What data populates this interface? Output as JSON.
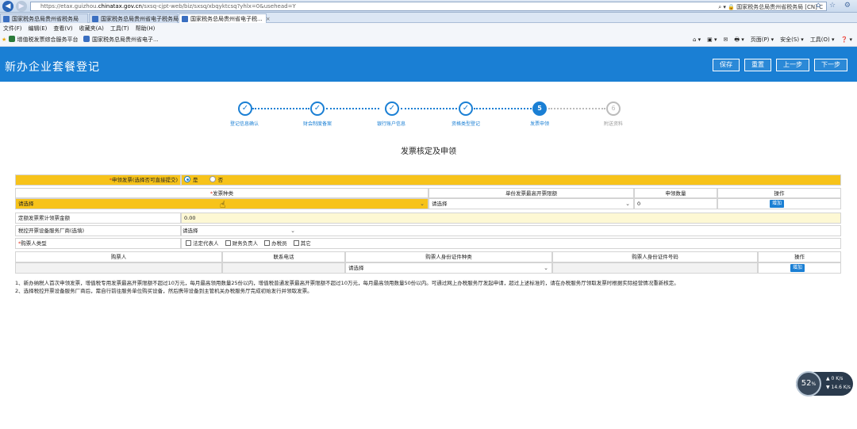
{
  "browser": {
    "url_prefix": "https://etax.guizhou.",
    "url_domain": "chinatax.gov.cn",
    "url_path": "/sxsq-cjpt-web/biz/sxsq/xbqyktcsq?yhlx=0&usehead=Y",
    "site_identity": "⌕ ▾ 🔒 国家税务总局贵州省税务局 [CN] C",
    "tabs": [
      {
        "label": "国家税务总局贵州省税务局"
      },
      {
        "label": "国家税务总局贵州省电子税务局"
      },
      {
        "label": "国家税务总局贵州省电子税...",
        "close": "×"
      }
    ],
    "menu": [
      "文件(F)",
      "编辑(E)",
      "查看(V)",
      "收藏夹(A)",
      "工具(T)",
      "帮助(H)"
    ],
    "favorites": [
      "增值税发票综合服务平台",
      "国家税务总局贵州省电子..."
    ],
    "commands": [
      "⌂ ▾",
      "▣ ▾",
      "✉",
      "🖶 ▾",
      "页面(P) ▾",
      "安全(S) ▾",
      "工具(O) ▾",
      "❓ ▾"
    ]
  },
  "header": {
    "title": "新办企业套餐登记",
    "buttons": {
      "save": "保存",
      "reset": "重置",
      "prev": "上一步",
      "next": "下一步"
    }
  },
  "steps": [
    {
      "label": "登记信息确认",
      "state": "done"
    },
    {
      "label": "财会制度备案",
      "state": "done"
    },
    {
      "label": "银行账户信息",
      "state": "done"
    },
    {
      "label": "资格类型登记",
      "state": "done"
    },
    {
      "label": "发票申领",
      "state": "current",
      "num": "5"
    },
    {
      "label": "附送资料",
      "state": "future",
      "num": "6"
    }
  ],
  "section_title": "发票核定及申领",
  "form": {
    "apply_invoice_label": "申领发票(选择否可直接提交)",
    "apply_yes": "是",
    "apply_no": "否",
    "columns": {
      "invoice_type": "发票种类",
      "max_amount": "单份发票最高开票限额",
      "quantity": "申领数量",
      "action": "操作"
    },
    "invoice_row": {
      "invoice_type": "请选择",
      "max_amount": "请选择",
      "quantity": "0",
      "add": "增加"
    },
    "quota_label": "定额发票累计领票金额",
    "quota_value": "0.00",
    "vendor_label": "税控开票设备服务厂商(选填)",
    "vendor_value": "请选择",
    "buyer_type_label": "购票人类型",
    "buyer_types": [
      "法定代表人",
      "财务负责人",
      "办税员",
      "其它"
    ],
    "buyer_columns": {
      "buyer": "购票人",
      "phone": "联系电话",
      "id_type": "购票人身份证件种类",
      "id_number": "购票人身份证件号码",
      "action": "操作"
    },
    "buyer_row": {
      "id_type": "请选择",
      "add": "增加"
    }
  },
  "notes": [
    "1、新办纳税人首次申领发票，增值税专用发票最高开票限额不超过10万元，每月最高领用数量25份以内，增值税普通发票最高开票限额不超过10万元，每月最高领用数量50份以内。可通过网上办税服务厅发起申请，超过上述标准的，请在办税服务厅领取发票时根据实际经营情况重新核定。",
    "2、选择税控开票设备服务厂商后，需自行前往服务单位购买设备，然后携带设备到主管机关办税服务厅完成初始发行并领取发票。"
  ],
  "widget": {
    "percent": "52",
    "percent_sign": "%",
    "up": "0",
    "up_unit": "K/s",
    "down": "14.6",
    "down_unit": "K/s"
  }
}
